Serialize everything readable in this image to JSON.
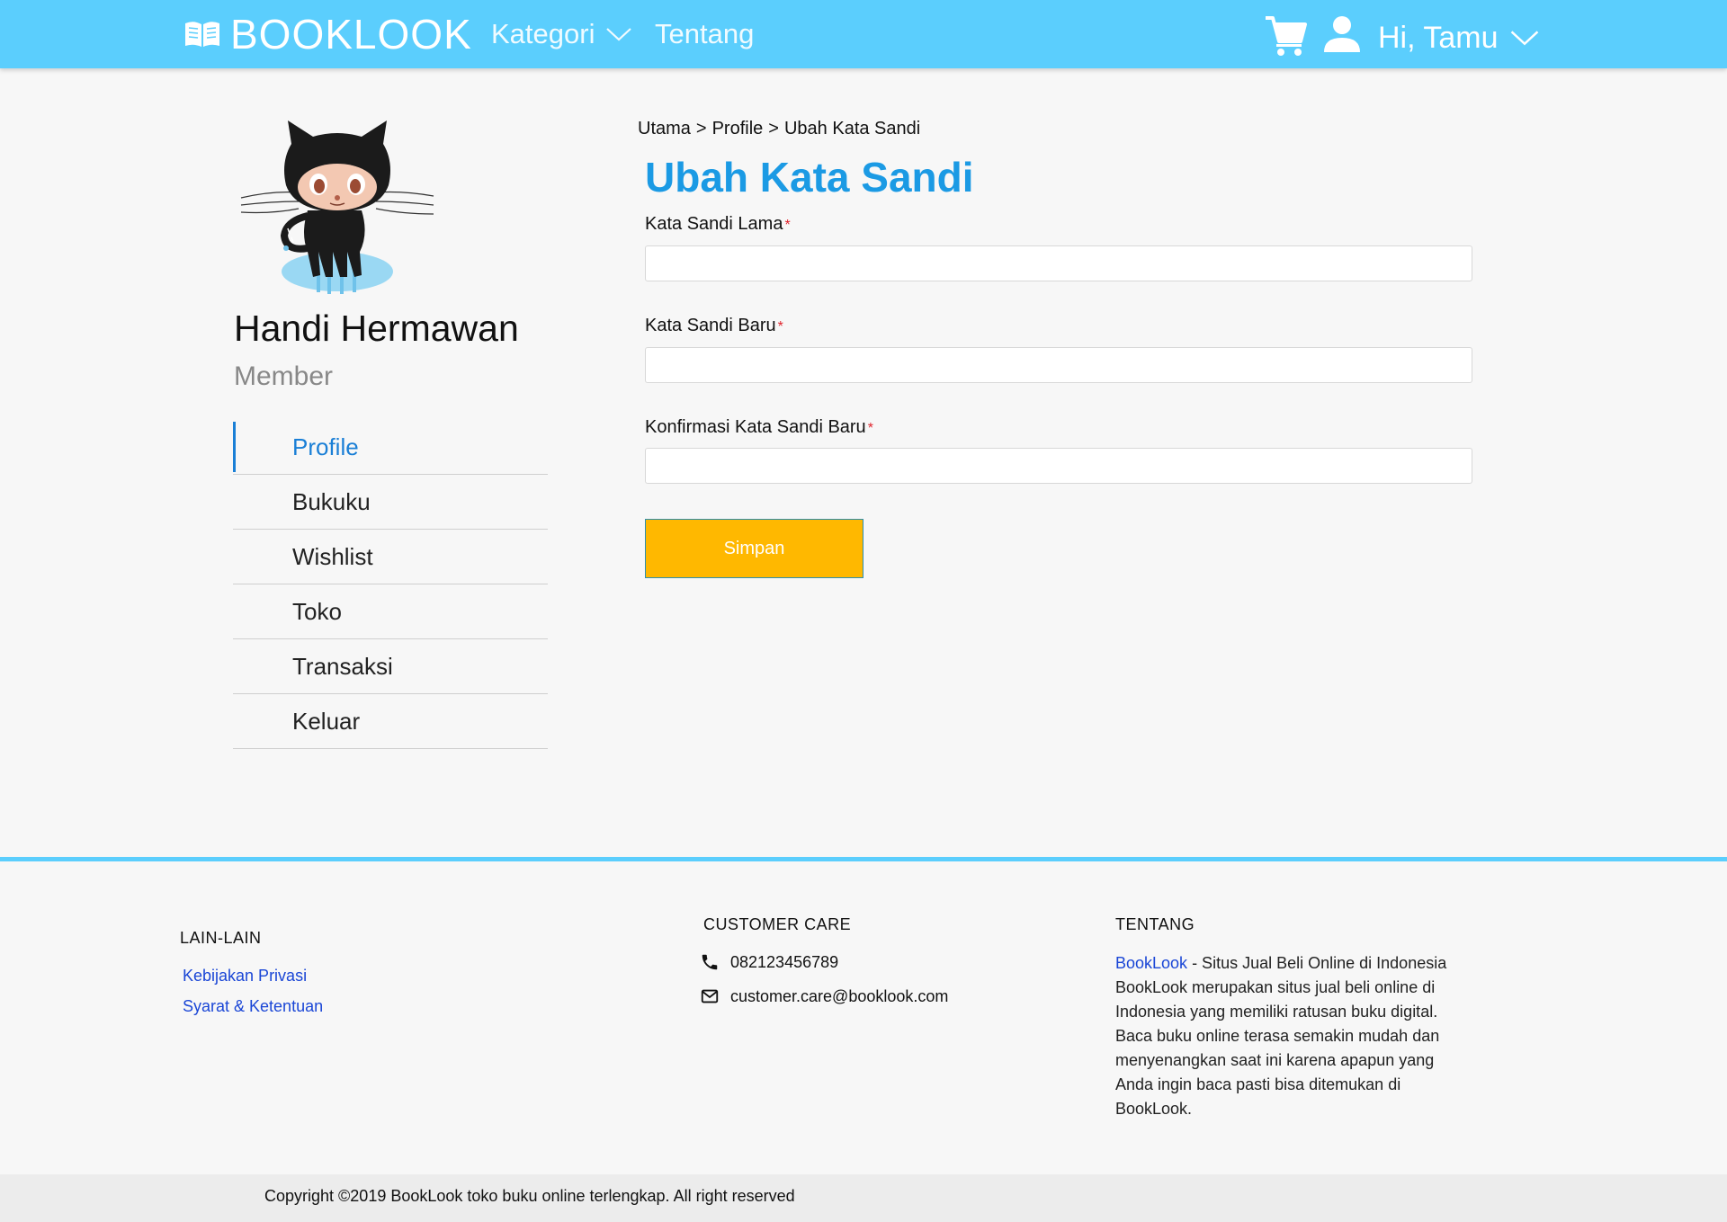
{
  "header": {
    "brand": "BOOKLOOK",
    "nav": {
      "kategori": "Kategori",
      "tentang": "Tentang"
    },
    "greeting": "Hi, Tamu",
    "icons": [
      "book-icon",
      "chevron-down-icon",
      "cart-icon",
      "user-icon"
    ]
  },
  "sidebar": {
    "name": "Handi Hermawan",
    "role": "Member",
    "items": [
      {
        "label": "Profile",
        "active": true
      },
      {
        "label": "Bukuku"
      },
      {
        "label": "Wishlist"
      },
      {
        "label": "Toko"
      },
      {
        "label": "Transaksi"
      },
      {
        "label": "Keluar"
      }
    ]
  },
  "breadcrumb": [
    "Utama",
    ">",
    "Profile",
    ">",
    "Ubah Kata Sandi"
  ],
  "main": {
    "title": "Ubah Kata Sandi",
    "fields": [
      {
        "label": "Kata Sandi Lama",
        "required": "*",
        "value": ""
      },
      {
        "label": "Kata Sandi Baru",
        "required": "*",
        "value": ""
      },
      {
        "label": "Konfirmasi Kata Sandi Baru",
        "required": "*",
        "value": ""
      }
    ],
    "save_label": "Simpan"
  },
  "footer": {
    "lain_lain": {
      "heading": "LAIN-LAIN",
      "links": [
        "Kebijakan Privasi",
        "Syarat & Ketentuan"
      ]
    },
    "customer_care": {
      "heading": "CUSTOMER CARE",
      "phone": "082123456789",
      "email": "customer.care@booklook.com"
    },
    "tentang": {
      "heading": "TENTANG",
      "brand": "BookLook",
      "text": " - Situs Jual Beli Online di Indonesia BookLook merupakan situs jual beli online di Indonesia yang memiliki ratusan buku digital. Baca buku online terasa semakin mudah dan menyenangkan saat ini karena apapun yang Anda ingin baca pasti bisa ditemukan di BookLook."
    },
    "copyright": "Copyright ©2019 BookLook toko buku online terlengkap. All right reserved"
  },
  "colors": {
    "header_bg": "#5bcefd",
    "title_blue": "#1b9ae4",
    "active_blue": "#1a7fd6",
    "save_button": "#ffb800",
    "link_blue": "#1a46d6",
    "required_red": "#e0242d"
  }
}
